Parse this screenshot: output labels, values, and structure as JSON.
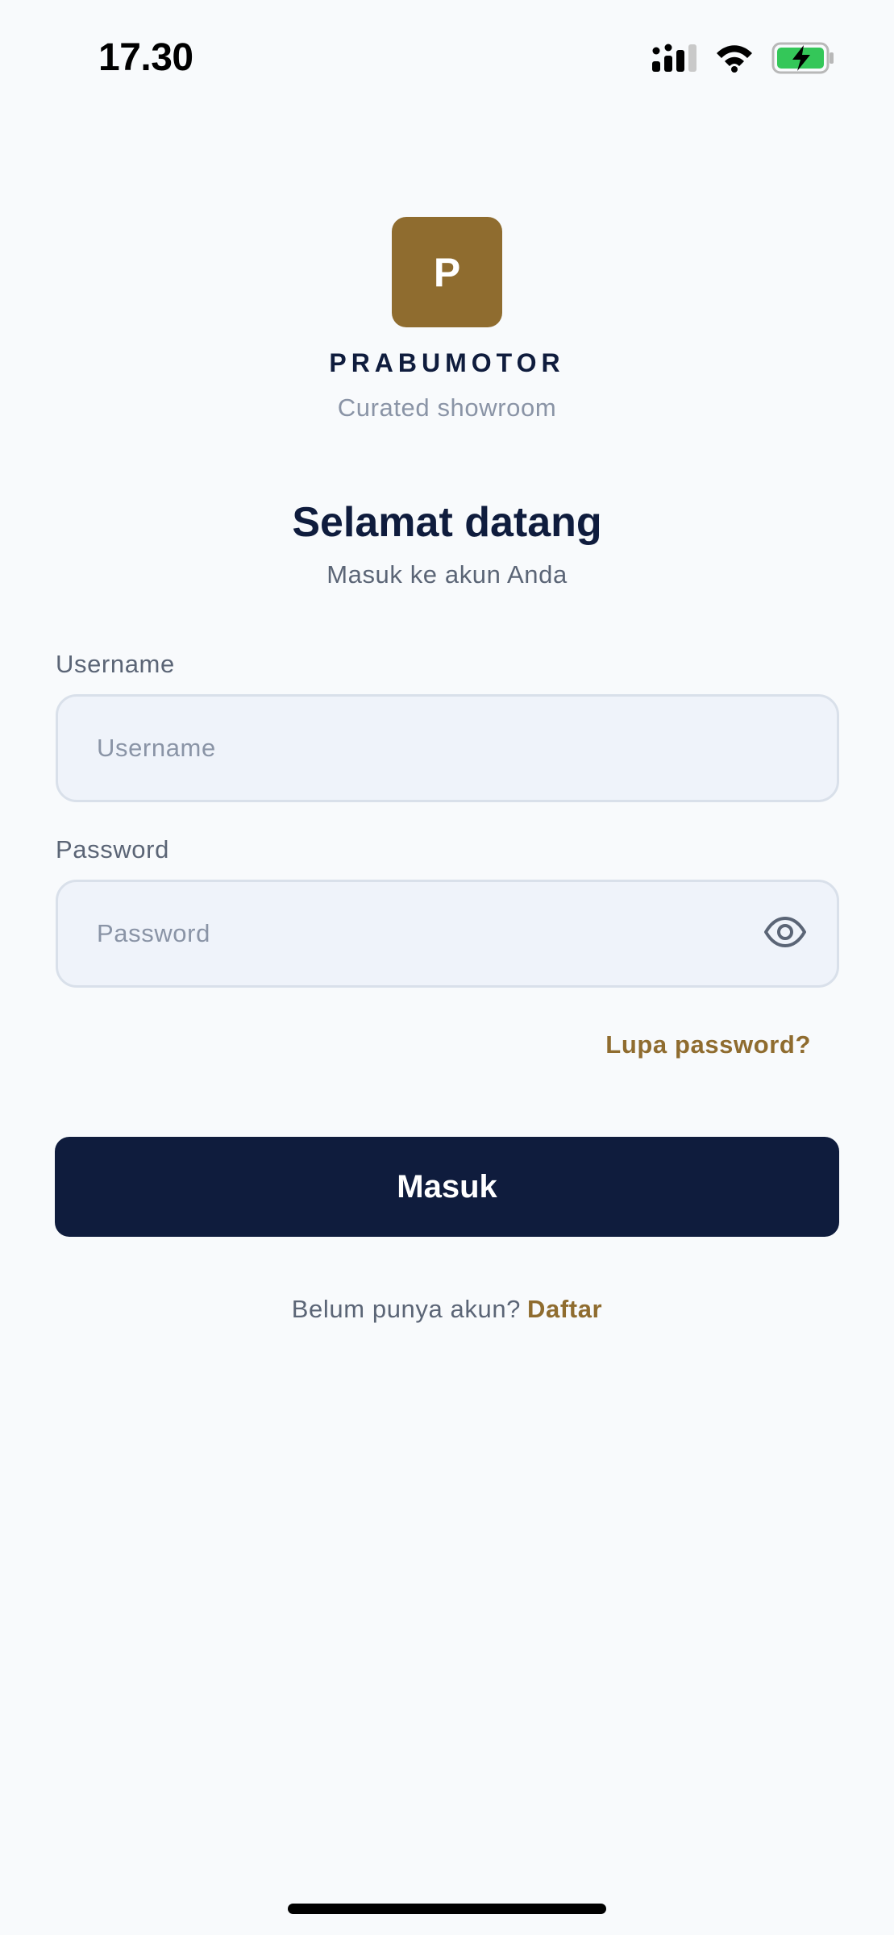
{
  "status_bar": {
    "time": "17.30"
  },
  "brand": {
    "logo_letter": "P",
    "name": "PRABUMOTOR",
    "tagline": "Curated showroom"
  },
  "heading": {
    "title": "Selamat datang",
    "subtitle": "Masuk ke akun Anda"
  },
  "form": {
    "username": {
      "label": "Username",
      "placeholder": "Username",
      "value": ""
    },
    "password": {
      "label": "Password",
      "placeholder": "Password",
      "value": ""
    },
    "forgot_password": "Lupa password?",
    "submit_label": "Masuk"
  },
  "signup": {
    "prompt": "Belum punya akun?",
    "link": "Daftar"
  },
  "colors": {
    "brand_gold": "#8f6c2f",
    "navy": "#0f1c3d",
    "background": "#f8fafc",
    "field_bg": "#eff3fa",
    "battery_green": "#34c759"
  },
  "icons": {
    "cellular": "cellular-signal-icon",
    "wifi": "wifi-icon",
    "battery": "battery-charging-icon",
    "eye": "eye-icon"
  }
}
